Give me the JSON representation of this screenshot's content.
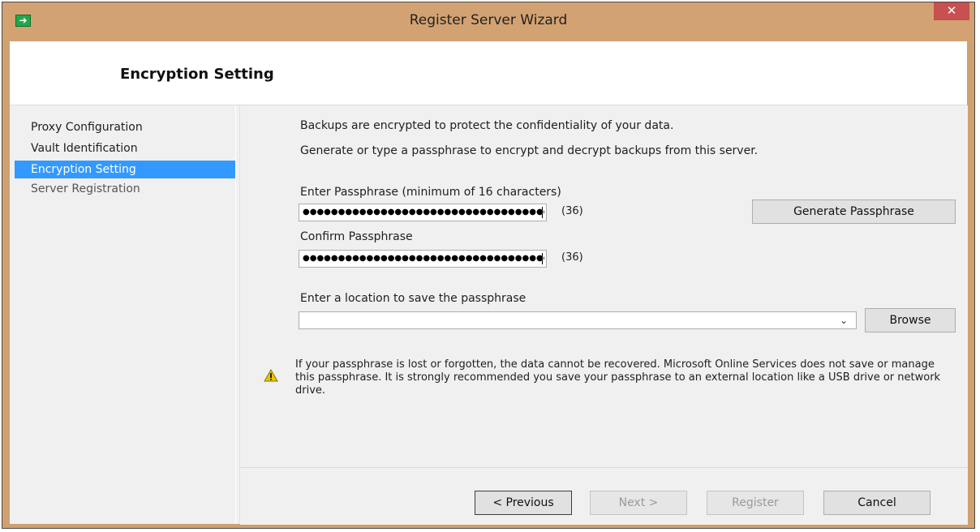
{
  "window": {
    "title": "Register Server Wizard",
    "close_glyph": "✕",
    "app_icon": "wizard-arrow-icon"
  },
  "header": {
    "title": "Encryption Setting"
  },
  "sidebar": {
    "items": [
      {
        "label": "Proxy Configuration",
        "state": "done"
      },
      {
        "label": "Vault Identification",
        "state": "done"
      },
      {
        "label": "Encryption Setting",
        "state": "active"
      },
      {
        "label": "Server Registration",
        "state": "pending"
      }
    ]
  },
  "main": {
    "intro_line1": "Backups are encrypted to protect the confidentiality of your data.",
    "intro_line2": "Generate or type a passphrase to encrypt and decrypt backups from this server.",
    "passphrase": {
      "label": "Enter Passphrase (minimum of 16 characters)",
      "masked_value": "●●●●●●●●●●●●●●●●●●●●●●●●●●●●●●●●●●●●",
      "count": "(36)"
    },
    "confirm": {
      "label": "Confirm Passphrase",
      "masked_value": "●●●●●●●●●●●●●●●●●●●●●●●●●●●●●●●●●●●●",
      "count": "(36)"
    },
    "generate_button": "Generate Passphrase",
    "location": {
      "label": "Enter a location to save the passphrase",
      "value": "",
      "dropdown_glyph": "⌄"
    },
    "browse_button": "Browse",
    "warning": {
      "icon": "warning-icon",
      "text": "If your passphrase is lost or forgotten, the data cannot be recovered. Microsoft Online Services does not save or manage this passphrase. It is strongly recommended you save your passphrase to an external location like a USB drive or network drive."
    }
  },
  "footer": {
    "previous": "< Previous",
    "next": "Next >",
    "register": "Register",
    "cancel": "Cancel"
  },
  "colors": {
    "titlebar": "#d3a272",
    "close": "#c75050",
    "selection": "#3399ff",
    "warning": "#e8c800"
  }
}
